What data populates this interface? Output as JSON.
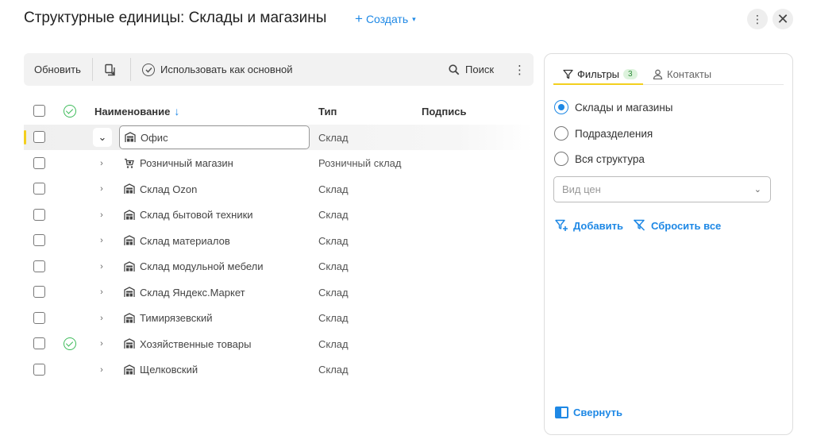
{
  "header": {
    "title": "Структурные единицы: Склады и магазины",
    "create_label": "Создать"
  },
  "toolbar": {
    "refresh_label": "Обновить",
    "use_as_main_label": "Использовать как основной",
    "search_label": "Поиск"
  },
  "table": {
    "columns": {
      "name": "Наименование",
      "type": "Тип",
      "signature": "Подпись"
    },
    "rows": [
      {
        "name": "Офис",
        "type": "Склад",
        "icon": "warehouse-icon",
        "expanded": true,
        "selected": true,
        "main": false
      },
      {
        "name": "Розничный магазин",
        "type": "Розничный склад",
        "icon": "retail-store-icon",
        "expanded": false,
        "selected": false,
        "main": false
      },
      {
        "name": "Склад Ozon",
        "type": "Склад",
        "icon": "warehouse-icon",
        "expanded": false,
        "selected": false,
        "main": false
      },
      {
        "name": "Склад бытовой техники",
        "type": "Склад",
        "icon": "warehouse-icon",
        "expanded": false,
        "selected": false,
        "main": false
      },
      {
        "name": "Склад материалов",
        "type": "Склад",
        "icon": "warehouse-icon",
        "expanded": false,
        "selected": false,
        "main": false
      },
      {
        "name": "Склад модульной мебели",
        "type": "Склад",
        "icon": "warehouse-icon",
        "expanded": false,
        "selected": false,
        "main": false
      },
      {
        "name": "Склад Яндекс.Маркет",
        "type": "Склад",
        "icon": "warehouse-icon",
        "expanded": false,
        "selected": false,
        "main": false
      },
      {
        "name": "Тимирязевский",
        "type": "Склад",
        "icon": "warehouse-icon",
        "expanded": false,
        "selected": false,
        "main": false
      },
      {
        "name": "Хозяйственные товары",
        "type": "Склад",
        "icon": "warehouse-icon",
        "expanded": false,
        "selected": false,
        "main": true
      },
      {
        "name": "Щелковский",
        "type": "Склад",
        "icon": "warehouse-icon",
        "expanded": false,
        "selected": false,
        "main": false
      }
    ]
  },
  "filters_panel": {
    "tabs": {
      "filters_label": "Фильтры",
      "filters_count": "3",
      "contacts_label": "Контакты"
    },
    "radio_options": [
      {
        "label": "Склады и магазины",
        "checked": true
      },
      {
        "label": "Подразделения",
        "checked": false
      },
      {
        "label": "Вся структура",
        "checked": false
      }
    ],
    "price_type_placeholder": "Вид цен",
    "add_label": "Добавить",
    "reset_all_label": "Сбросить все",
    "collapse_label": "Свернуть"
  },
  "colors": {
    "accent": "#1e88e5",
    "selection_marker": "#f3cf1e",
    "main_check": "#3dbb5a"
  }
}
